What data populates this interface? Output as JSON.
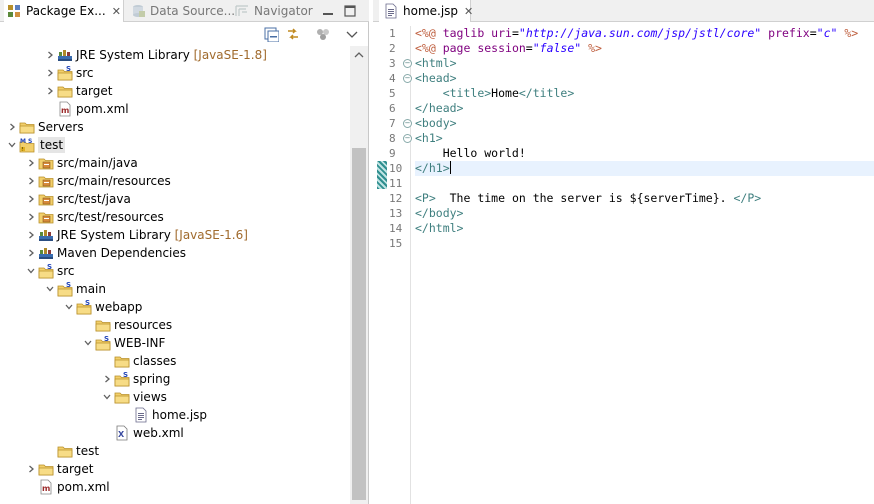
{
  "left_tabs": [
    {
      "label": "Package Ex...",
      "icon": "package-explorer-icon",
      "active": true,
      "close": "✕"
    },
    {
      "label": "Data Source...",
      "icon": "data-source-icon",
      "active": false
    },
    {
      "label": "Navigator",
      "icon": "navigator-icon",
      "active": false
    }
  ],
  "left_toolbar": [
    "collapse-all-icon",
    "link-with-editor-icon",
    "focus-icon",
    "view-menu-icon"
  ],
  "tree": [
    {
      "label": "JRE System Library",
      "deco": "[JavaSE-1.8]",
      "icon": "library-icon",
      "toggle": "collapsed",
      "level": 2
    },
    {
      "label": "src",
      "icon": "spring-folder-icon",
      "toggle": "collapsed",
      "level": 2
    },
    {
      "label": "target",
      "icon": "folder-icon",
      "toggle": "collapsed",
      "level": 2
    },
    {
      "label": "pom.xml",
      "icon": "maven-file-icon",
      "toggle": "none",
      "level": 2
    },
    {
      "label": "Servers",
      "icon": "folder-icon",
      "toggle": "collapsed",
      "level": 0
    },
    {
      "label": "test",
      "icon": "maven-project-icon",
      "toggle": "expanded",
      "level": 0,
      "selected": true
    },
    {
      "label": "src/main/java",
      "icon": "source-folder-icon",
      "toggle": "collapsed",
      "level": 1
    },
    {
      "label": "src/main/resources",
      "icon": "source-folder-icon",
      "toggle": "collapsed",
      "level": 1
    },
    {
      "label": "src/test/java",
      "icon": "source-folder-icon",
      "toggle": "collapsed",
      "level": 1
    },
    {
      "label": "src/test/resources",
      "icon": "source-folder-icon",
      "toggle": "collapsed",
      "level": 1
    },
    {
      "label": "JRE System Library",
      "deco": "[JavaSE-1.6]",
      "icon": "library-icon",
      "toggle": "collapsed",
      "level": 1
    },
    {
      "label": "Maven Dependencies",
      "icon": "library-icon",
      "toggle": "collapsed",
      "level": 1
    },
    {
      "label": "src",
      "icon": "spring-folder-icon",
      "toggle": "expanded",
      "level": 1
    },
    {
      "label": "main",
      "icon": "spring-folder-icon",
      "toggle": "expanded",
      "level": 2
    },
    {
      "label": "webapp",
      "icon": "spring-folder-icon",
      "toggle": "expanded",
      "level": 3
    },
    {
      "label": "resources",
      "icon": "folder-icon",
      "toggle": "none",
      "level": 4
    },
    {
      "label": "WEB-INF",
      "icon": "spring-folder-icon",
      "toggle": "expanded",
      "level": 4
    },
    {
      "label": "classes",
      "icon": "folder-icon",
      "toggle": "none",
      "level": 5
    },
    {
      "label": "spring",
      "icon": "spring-folder-icon",
      "toggle": "collapsed",
      "level": 5
    },
    {
      "label": "views",
      "icon": "folder-icon",
      "toggle": "expanded",
      "level": 5
    },
    {
      "label": "home.jsp",
      "icon": "jsp-file-icon",
      "toggle": "none",
      "level": 6
    },
    {
      "label": "web.xml",
      "icon": "xml-file-icon",
      "toggle": "none",
      "level": 5
    },
    {
      "label": "test",
      "icon": "folder-icon",
      "toggle": "none",
      "level": 2
    },
    {
      "label": "target",
      "icon": "folder-icon",
      "toggle": "collapsed",
      "level": 1
    },
    {
      "label": "pom.xml",
      "icon": "maven-file-icon",
      "toggle": "none",
      "level": 1
    }
  ],
  "editor_tab": {
    "label": "home.jsp",
    "icon": "jsp-file-icon",
    "close": "✕"
  },
  "code": {
    "current_line": 10,
    "folds": [
      3,
      4,
      7,
      8
    ],
    "lines": [
      [
        [
          "dir",
          "<%@ "
        ],
        [
          "attr",
          "taglib "
        ],
        [
          "attr",
          "uri"
        ],
        [
          "text",
          "="
        ],
        [
          "str",
          "\"http://java.sun.com/jsp/jstl/core\""
        ],
        [
          "text",
          " "
        ],
        [
          "attr",
          "prefix"
        ],
        [
          "text",
          "="
        ],
        [
          "str",
          "\"c\""
        ],
        [
          "dir",
          " %>"
        ]
      ],
      [
        [
          "dir",
          "<%@ "
        ],
        [
          "attr",
          "page "
        ],
        [
          "attr",
          "session"
        ],
        [
          "text",
          "="
        ],
        [
          "str",
          "\"false\""
        ],
        [
          "dir",
          " %>"
        ]
      ],
      [
        [
          "tag",
          "<html>"
        ]
      ],
      [
        [
          "tag",
          "<head>"
        ]
      ],
      [
        [
          "text",
          "    "
        ],
        [
          "tag",
          "<title>"
        ],
        [
          "text",
          "Home"
        ],
        [
          "tag",
          "</title>"
        ]
      ],
      [
        [
          "tag",
          "</head>"
        ]
      ],
      [
        [
          "tag",
          "<body>"
        ]
      ],
      [
        [
          "tag",
          "<h1>"
        ]
      ],
      [
        [
          "text",
          "    Hello world!"
        ]
      ],
      [
        [
          "tag",
          "</h1>"
        ]
      ],
      [],
      [
        [
          "tag",
          "<P>"
        ],
        [
          "text",
          "  The time on the server is ${serverTime}. "
        ],
        [
          "tag",
          "</P>"
        ]
      ],
      [
        [
          "tag",
          "</body>"
        ]
      ],
      [
        [
          "tag",
          "</html>"
        ]
      ],
      []
    ]
  }
}
